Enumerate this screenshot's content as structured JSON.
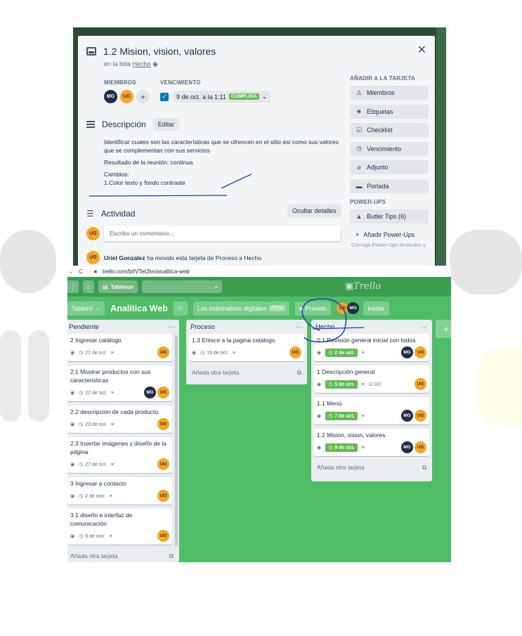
{
  "colors": {
    "board_green": "#4fbd65",
    "done_green": "#61bd4f",
    "avatar_mg": "#1f2d4a",
    "avatar_ug": "#f5a623",
    "pen_blue": "#1d3ec7"
  },
  "modal": {
    "title": "1.2 Mision, vision, valores",
    "in_list_prefix": "en la lista",
    "in_list_name": "Hecho",
    "members_label": "MIEMBROS",
    "members": [
      "MG",
      "UG"
    ],
    "due_label": "VENCIMIENTO",
    "due_text": "9 de oct. a la 1:11",
    "due_badge": "CUMPLIDA",
    "description_label": "Descripción",
    "edit_label": "Editar",
    "description_lines": [
      "Identificar cuales son las características que se ofrencen en el sitio así como sus valores que se complementan con sus servicios",
      "Resultado de la reunión: continua",
      "Cambios:",
      "1.Color texto y fondo contraste"
    ],
    "activity_label": "Actividad",
    "hide_details_label": "Ocultar detalles",
    "comment_placeholder": "Escriba un comentario...",
    "commenter_avatar": "UG",
    "activity_user": "Uriel Gonzalez",
    "activity_text": " ha movido esta tarjeta de Proceso a Hecho",
    "add_to_card_label": "AÑADIR A LA TARJETA",
    "add_buttons": [
      {
        "label": "Miembros",
        "icon": "person-icon"
      },
      {
        "label": "Etiquetas",
        "icon": "tag-icon"
      },
      {
        "label": "Checklist",
        "icon": "checklist-icon"
      },
      {
        "label": "Vencimiento",
        "icon": "clock-icon"
      },
      {
        "label": "Adjunto",
        "icon": "paperclip-icon"
      },
      {
        "label": "Portada",
        "icon": "cover-icon"
      }
    ],
    "powerups_label": "POWER-UPS",
    "butler_label": "Butler Tips (6)",
    "add_powerups_label": "Añadir Power-Ups",
    "powerups_note": "Consiga Power-Ups ilimitados y"
  },
  "browser": {
    "url": "trello.com/b/tVTet2kn/analitica-web"
  },
  "topbar": {
    "boards_label": "Tableros",
    "logo": "Trello"
  },
  "board": {
    "board_btn": "Tablero",
    "title": "Analítica Web",
    "team": "Los indomables digitales",
    "free": "Free",
    "privacy": "Privado",
    "members": [
      "UG",
      "MG"
    ],
    "invite": "Invitar"
  },
  "lists": [
    {
      "name": "Pendiente",
      "cards": [
        {
          "title": "2 Ingresar catálogo",
          "due": "21 de oct.",
          "done": false,
          "members": [
            "UG"
          ],
          "checklist": ""
        },
        {
          "title": "2.1 Mostrar productos con sus caracteristicas",
          "due": "22 de oct.",
          "done": false,
          "members": [
            "MG",
            "UG"
          ],
          "checklist": ""
        },
        {
          "title": "2.2 descripcion de cada producto",
          "due": "23 de oct.",
          "done": false,
          "members": [
            "UG"
          ],
          "checklist": ""
        },
        {
          "title": "2.3 Insertar imágenes y diseño de la página",
          "due": "27 de oct.",
          "done": false,
          "members": [
            "UG"
          ],
          "checklist": ""
        },
        {
          "title": "3 Ingresar a contacto",
          "due": "2 de nov.",
          "done": false,
          "members": [
            "UG"
          ],
          "checklist": ""
        },
        {
          "title": "3.1 diseño e interfaz de comunicación",
          "due": "6 de nov.",
          "done": false,
          "members": [
            "UG"
          ],
          "checklist": ""
        }
      ],
      "add_label": "Añada otra tarjeta"
    },
    {
      "name": "Proceso",
      "cards": [
        {
          "title": "1.3 Enlace a la pagina catálogo",
          "due": "19 de oct.",
          "done": false,
          "members": [
            "UG"
          ],
          "checklist": ""
        }
      ],
      "add_label": "Añada otra tarjeta"
    },
    {
      "name": "Hecho",
      "cards": [
        {
          "title": "0.1 Revisión general inicial con todos",
          "due": "2 de oct.",
          "done": true,
          "members": [
            "MG",
            "UG"
          ],
          "checklist": ""
        },
        {
          "title": "1 Descripción general",
          "due": "5 de oct.",
          "done": true,
          "members": [
            "UG"
          ],
          "checklist": "0/2"
        },
        {
          "title": "1.1 Menú",
          "due": "7 de oct.",
          "done": true,
          "members": [
            "MG",
            "UG"
          ],
          "checklist": ""
        },
        {
          "title": "1.2 Mision, vision, valores",
          "due": "9 de oct.",
          "done": true,
          "members": [
            "MG",
            "UG"
          ],
          "checklist": ""
        }
      ],
      "add_label": "Añada otra tarjeta"
    }
  ]
}
